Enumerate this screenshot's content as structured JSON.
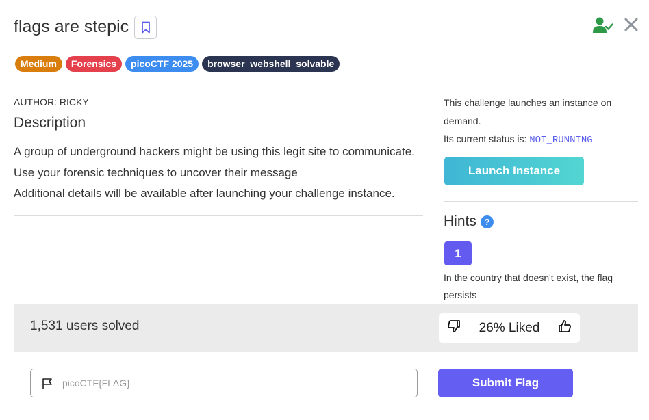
{
  "challenge": {
    "title": "flags are stepic",
    "tags": [
      {
        "label": "Medium",
        "color": "#d97d0d"
      },
      {
        "label": "Forensics",
        "color": "#e5414d"
      },
      {
        "label": "picoCTF 2025",
        "color": "#3d8df0"
      },
      {
        "label": "browser_webshell_solvable",
        "color": "#2b3450"
      }
    ],
    "author": "AUTHOR: RICKY",
    "description_heading": "Description",
    "description_lines": [
      "A group of underground hackers might be using this legit site to communicate.",
      "Use your forensic techniques to uncover their message",
      "Additional details will be available after launching your challenge instance."
    ]
  },
  "header_icons": {
    "bookmark": "bookmark-icon",
    "user_check": "user-check-icon",
    "close": "close-icon",
    "user_check_color": "#2e9a48"
  },
  "instance": {
    "launch_text": "This challenge launches an instance on demand.",
    "status_prefix": "Its current status is:",
    "status_value": "NOT_RUNNING",
    "launch_button": "Launch Instance"
  },
  "hints": {
    "heading": "Hints",
    "help_glyph": "?",
    "items": [
      {
        "number": "1",
        "text": "In the country that doesn't exist, the flag persists"
      }
    ]
  },
  "stats": {
    "solved_text": "1,531 users solved",
    "liked_text": "26% Liked"
  },
  "flag_form": {
    "placeholder": "picoCTF{FLAG}",
    "submit_label": "Submit Flag"
  }
}
